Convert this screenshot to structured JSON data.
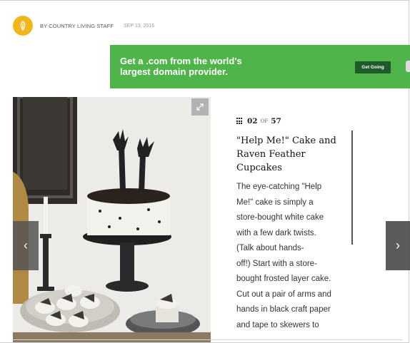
{
  "byline": {
    "author": "BY COUNTRY LIVING STAFF",
    "date": "SEP 13, 2016"
  },
  "ad": {
    "line1": "Get a .com from the world's",
    "line2": "largest domain provider.",
    "cta": "Get Going",
    "bg_color": "#4fb449"
  },
  "slideshow": {
    "current": "02",
    "of_label": "OF",
    "total": "57",
    "title_lines": [
      "\"Help Me!\" Cake and",
      "Raven Feather",
      "Cupcakes"
    ],
    "body_lines": [
      "The eye-catching \"Help",
      "Me!\" cake is simply a",
      "store-bought white cake",
      "with a few dark twists.",
      "(Talk about hands-",
      "off!) Start with a store-",
      "bought frosted layer cake.",
      "Cut out a pair of arms and",
      "hands in black craft paper",
      "and tape to skewers to"
    ],
    "prev_icon": "chevron-left-icon",
    "next_icon": "chevron-right-icon",
    "expand_icon": "expand-icon"
  },
  "colors": {
    "avatar": "#f1b71a",
    "nav_button": "#4a4a4a"
  }
}
